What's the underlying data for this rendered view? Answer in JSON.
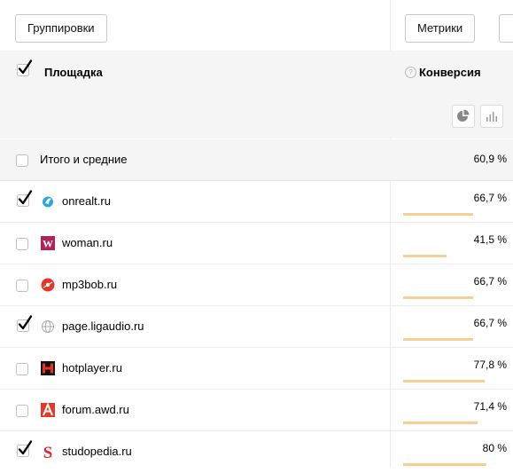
{
  "toolbar": {
    "groupings_label": "Группировки",
    "metrics_label": "Метрики"
  },
  "table": {
    "dimension_header": "Площадка",
    "metric_header": "Конверсия",
    "accent_color": "#f7cf93",
    "total": {
      "label": "Итого и средние",
      "value": "60,9 %"
    },
    "rows": [
      {
        "label": "onrealt.ru",
        "value": "66,7 %",
        "fraction": 0.667,
        "checked": true,
        "icon": "onrealt-favicon"
      },
      {
        "label": "woman.ru",
        "value": "41,5 %",
        "fraction": 0.415,
        "checked": false,
        "icon": "woman-favicon"
      },
      {
        "label": "mp3bob.ru",
        "value": "66,7 %",
        "fraction": 0.667,
        "checked": false,
        "icon": "mp3bob-favicon"
      },
      {
        "label": "page.ligaudio.ru",
        "value": "66,7 %",
        "fraction": 0.667,
        "checked": true,
        "icon": "globe-icon"
      },
      {
        "label": "hotplayer.ru",
        "value": "77,8 %",
        "fraction": 0.778,
        "checked": false,
        "icon": "hotplayer-favicon"
      },
      {
        "label": "forum.awd.ru",
        "value": "71,4 %",
        "fraction": 0.714,
        "checked": false,
        "icon": "awd-favicon"
      },
      {
        "label": "studopedia.ru",
        "value": "80 %",
        "fraction": 0.8,
        "checked": true,
        "icon": "studopedia-favicon"
      }
    ]
  }
}
